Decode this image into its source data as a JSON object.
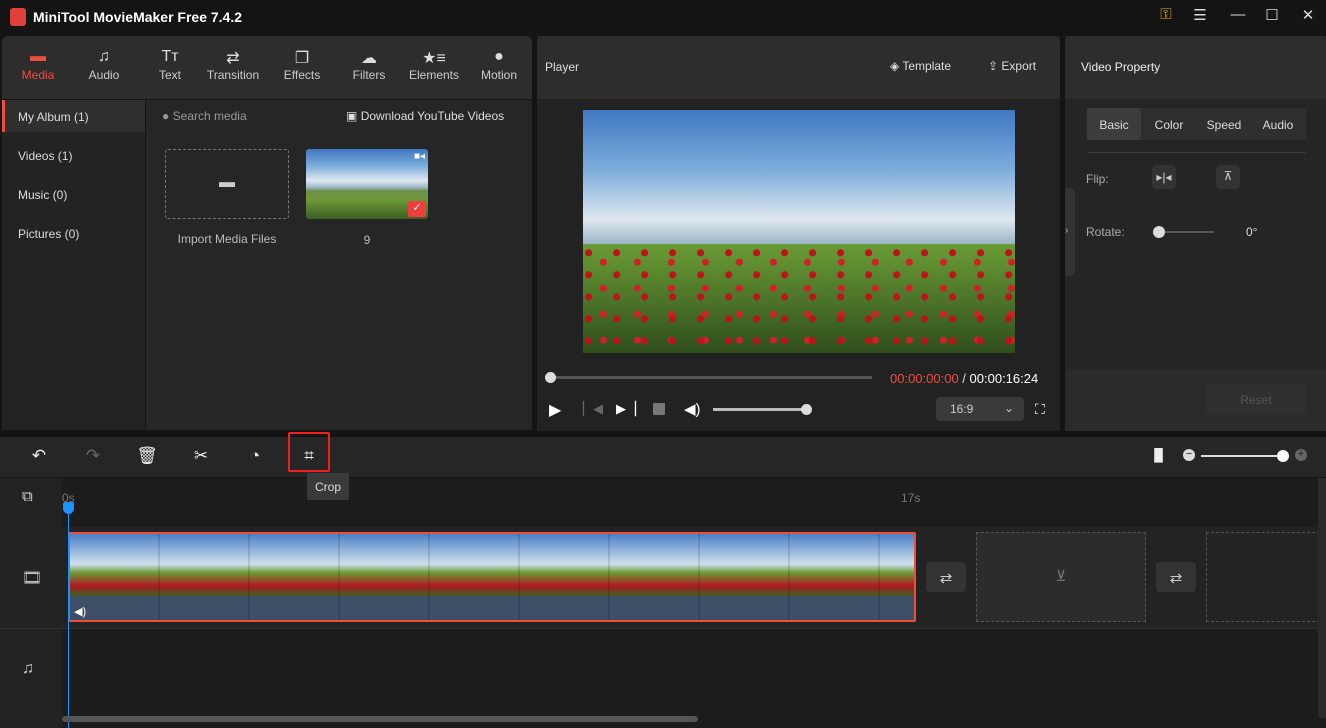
{
  "app": {
    "title": "MiniTool MovieMaker Free 7.4.2"
  },
  "window": {
    "icons": [
      "key-icon",
      "menu-icon",
      "minimize-icon",
      "maximize-icon",
      "close-icon"
    ]
  },
  "toolbar": {
    "tabs": [
      {
        "label": "Media",
        "icon": "folder-icon",
        "active": true
      },
      {
        "label": "Audio",
        "icon": "music-icon"
      },
      {
        "label": "Text",
        "icon": "text-icon"
      },
      {
        "label": "Transition",
        "icon": "transition-icon"
      },
      {
        "label": "Effects",
        "icon": "effects-icon"
      },
      {
        "label": "Filters",
        "icon": "filters-icon"
      },
      {
        "label": "Elements",
        "icon": "elements-icon"
      },
      {
        "label": "Motion",
        "icon": "motion-icon"
      }
    ]
  },
  "sidebar": {
    "items": [
      {
        "label": "My Album (1)",
        "active": true
      },
      {
        "label": "Videos (1)"
      },
      {
        "label": "Music (0)"
      },
      {
        "label": "Pictures (0)"
      }
    ]
  },
  "media": {
    "search_placeholder": "Search media",
    "download_label": "Download YouTube Videos",
    "import_label": "Import Media Files",
    "clip_name": "9"
  },
  "player": {
    "title": "Player",
    "template_label": "Template",
    "export_label": "Export",
    "current_time": "00:00:00:00",
    "separator": " / ",
    "total_time": "00:00:16:24",
    "aspect": "16:9",
    "progress": 0,
    "volume": 1.0
  },
  "property": {
    "title": "Video Property",
    "tabs": [
      "Basic",
      "Color",
      "Speed",
      "Audio"
    ],
    "active_tab": "Basic",
    "flip_label": "Flip:",
    "rotate_label": "Rotate:",
    "rotate_value": "0°",
    "reset_label": "Reset"
  },
  "timeline": {
    "tooltip": "Crop",
    "ruler": [
      "0s",
      "17s"
    ],
    "accent": "#ef4e3e"
  }
}
